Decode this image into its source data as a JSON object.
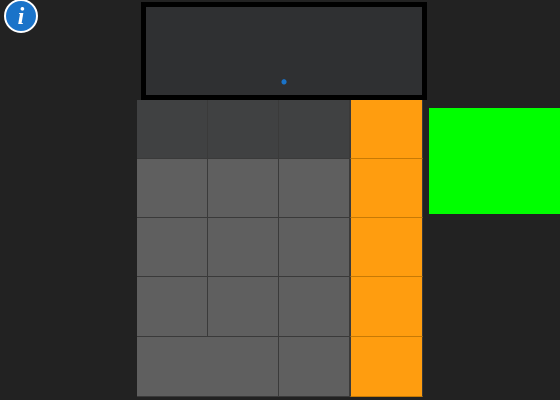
{
  "info_button": {
    "icon": "info-icon",
    "glyph": "i",
    "color": "#1a73c9"
  },
  "display": {
    "value": "•",
    "value_color": "#1a73c9"
  },
  "keypad": {
    "function_keys": [
      "",
      "",
      ""
    ],
    "operator_keys": [
      "",
      "",
      "",
      "",
      ""
    ],
    "number_keys": [
      "",
      "",
      "",
      "",
      "",
      "",
      "",
      "",
      "",
      "",
      ""
    ],
    "colors": {
      "function": "#404142",
      "number": "#5f5f5f",
      "operator": "#ff9d0f"
    }
  },
  "side_panel": {
    "color": "#00ff00"
  }
}
